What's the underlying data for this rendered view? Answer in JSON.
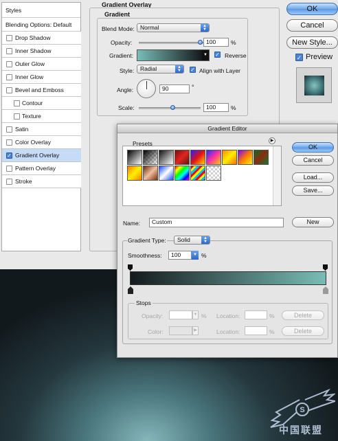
{
  "styles_panel": {
    "header": "Styles",
    "blending": "Blending Options: Default",
    "items": [
      {
        "label": "Drop Shadow",
        "checked": false
      },
      {
        "label": "Inner Shadow",
        "checked": false
      },
      {
        "label": "Outer Glow",
        "checked": false
      },
      {
        "label": "Inner Glow",
        "checked": false
      },
      {
        "label": "Bevel and Emboss",
        "checked": false
      },
      {
        "label": "Contour",
        "checked": false
      },
      {
        "label": "Texture",
        "checked": false
      },
      {
        "label": "Satin",
        "checked": false
      },
      {
        "label": "Color Overlay",
        "checked": false
      },
      {
        "label": "Gradient Overlay",
        "checked": true
      },
      {
        "label": "Pattern Overlay",
        "checked": false
      },
      {
        "label": "Stroke",
        "checked": false
      }
    ]
  },
  "overlay": {
    "section_title": "Gradient Overlay",
    "group_title": "Gradient",
    "blend_mode_label": "Blend Mode:",
    "blend_mode_value": "Normal",
    "opacity_label": "Opacity:",
    "opacity_value": "100",
    "percent": "%",
    "gradient_label": "Gradient:",
    "reverse_label": "Reverse",
    "style_label": "Style:",
    "style_value": "Radial",
    "align_label": "Align with Layer",
    "angle_label": "Angle:",
    "angle_value": "90",
    "degree": "°",
    "scale_label": "Scale:",
    "scale_value": "100",
    "opacity_level": 1.0,
    "scale_level": 0.55
  },
  "main_buttons": {
    "ok": "OK",
    "cancel": "Cancel",
    "new_style": "New Style...",
    "preview": "Preview"
  },
  "gradient_editor": {
    "title": "Gradient Editor",
    "presets_label": "Presets",
    "ok": "OK",
    "cancel": "Cancel",
    "load": "Load...",
    "save": "Save...",
    "name_label": "Name:",
    "name_value": "Custom",
    "new_button": "New",
    "type_label": "Gradient Type:",
    "type_value": "Solid",
    "smoothness_label": "Smoothness:",
    "smoothness_value": "100",
    "percent": "%",
    "stops_label": "Stops",
    "opacity_label": "Opacity:",
    "color_label": "Color:",
    "location_label": "Location:",
    "delete_label": "Delete",
    "gradient_start": "#141a1c",
    "gradient_end": "#79bdb6"
  },
  "watermark": {
    "text": "中国联盟"
  }
}
